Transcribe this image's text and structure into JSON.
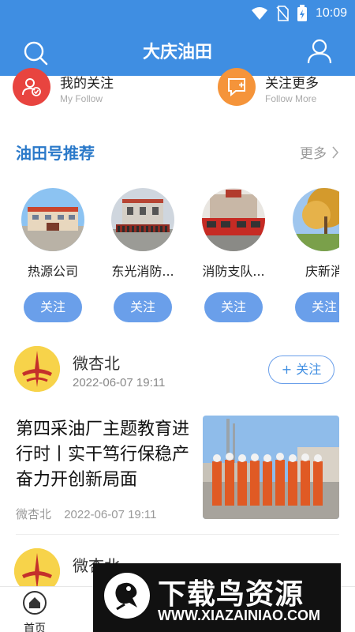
{
  "status": {
    "time": "10:09"
  },
  "nav": {
    "title": "大庆油田"
  },
  "follow": [
    {
      "title": "我的关注",
      "subtitle": "My Follow",
      "icon": "user-check-icon",
      "color": "#e8443f"
    },
    {
      "title": "关注更多",
      "subtitle": "Follow  More",
      "icon": "message-plus-icon",
      "color": "#f5943a"
    }
  ],
  "section": {
    "title": "油田号推荐",
    "more": "更多"
  },
  "accounts": [
    {
      "name": "热源公司",
      "button": "关注"
    },
    {
      "name": "东光消防...",
      "button": "关注"
    },
    {
      "name": "消防支队...",
      "button": "关注"
    },
    {
      "name": "庆新消",
      "button": "关注"
    }
  ],
  "feed": {
    "author": {
      "name": "微杏北",
      "time": "2022-06-07 19:11",
      "follow_button": "+ 关注"
    },
    "article": {
      "title": "第四采油厂主题教育进行时丨实干笃行保稳产 奋力开创新局面",
      "source": "微杏北",
      "time": "2022-06-07 19:11"
    },
    "author2": {
      "name": "微杏北"
    }
  },
  "tabbar": {
    "home_label": "首页"
  },
  "watermark": {
    "title": "下载鸟资源",
    "url": "WWW.XIAZAINIAO.COM"
  },
  "colors": {
    "primary": "#3f8ee2",
    "button": "#6a9fea",
    "section_title": "#2a79c9"
  }
}
